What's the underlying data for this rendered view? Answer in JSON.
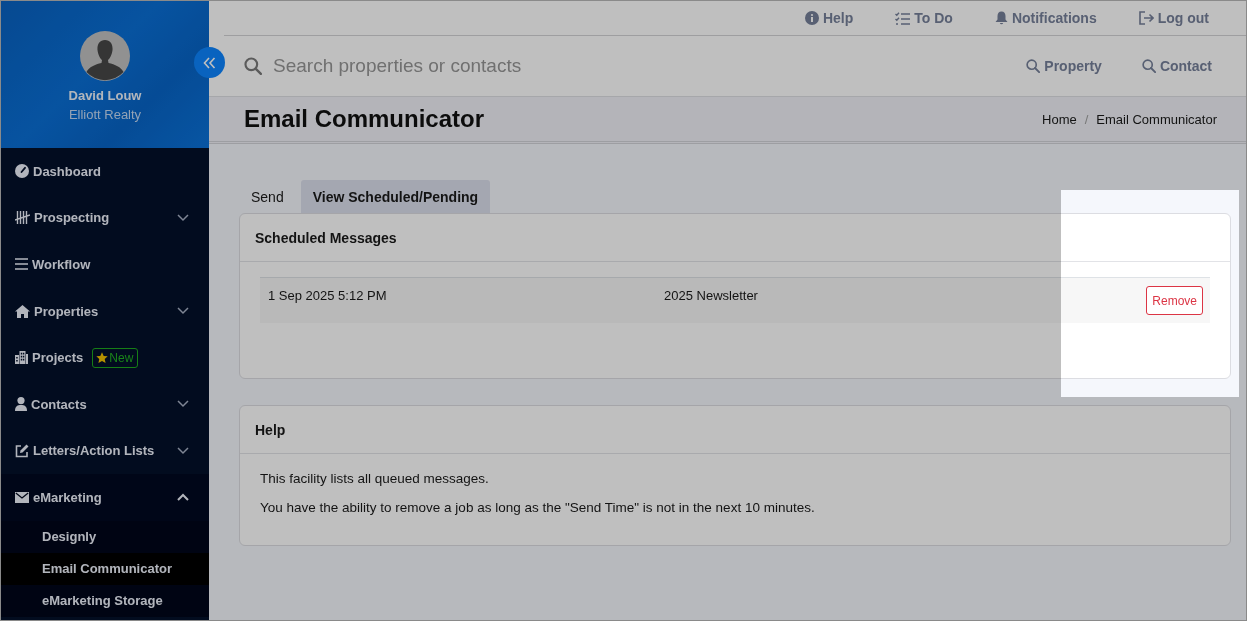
{
  "sidebar": {
    "user": {
      "name": "David Louw",
      "company": "Elliott Realty"
    },
    "menu": [
      {
        "kind": "link",
        "label": "Dashboard"
      },
      {
        "kind": "group",
        "label": "Prospecting",
        "expanded": false
      },
      {
        "kind": "link",
        "label": "Workflow"
      },
      {
        "kind": "group",
        "label": "Properties",
        "expanded": false
      },
      {
        "kind": "link",
        "label": "Projects",
        "badge": "New"
      },
      {
        "kind": "group",
        "label": "Contacts",
        "expanded": false
      },
      {
        "kind": "group",
        "label": "Letters/Action Lists",
        "expanded": false
      },
      {
        "kind": "group",
        "label": "eMarketing",
        "expanded": true,
        "children": [
          {
            "label": "Designly",
            "selected": false
          },
          {
            "label": "Email Communicator",
            "selected": true
          },
          {
            "label": "eMarketing Storage",
            "selected": false
          }
        ]
      }
    ]
  },
  "top_links": [
    {
      "label": "Help"
    },
    {
      "label": "To Do"
    },
    {
      "label": "Notifications"
    },
    {
      "label": "Log out"
    }
  ],
  "search": {
    "placeholder": "Search properties or contacts",
    "buttons": [
      {
        "label": "Property"
      },
      {
        "label": "Contact"
      }
    ]
  },
  "page_header": {
    "title": "Email Communicator",
    "breadcrumb": [
      "Home",
      "Email Communicator"
    ],
    "separator": "/"
  },
  "tabs": [
    {
      "label": "Send",
      "selected": false
    },
    {
      "label": "View Scheduled/Pending",
      "selected": true
    }
  ],
  "scheduled": {
    "title": "Scheduled Messages",
    "rows": [
      {
        "cells": [
          "1 Sep 2025 5:12 PM",
          "2025 Newsletter"
        ],
        "action": "Remove",
        "highlighted": true
      }
    ]
  },
  "help": {
    "title": "Help",
    "paragraphs": [
      "This facility lists all queued messages.",
      "You have the ability to remove a job as long as the \"Send Time\" is not in the next 10 minutes."
    ]
  }
}
